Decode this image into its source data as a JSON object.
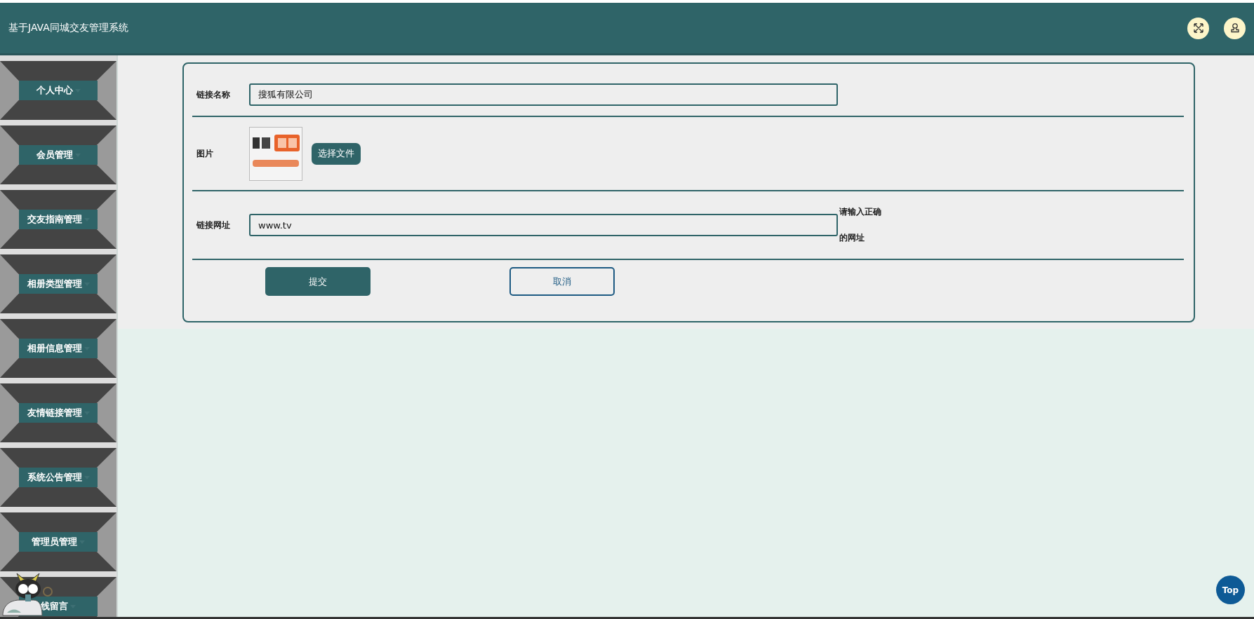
{
  "header": {
    "title": "基于JAVA同城交友管理系统"
  },
  "sidebar": {
    "items": [
      {
        "label": "个人中心"
      },
      {
        "label": "会员管理"
      },
      {
        "label": "交友指南管理"
      },
      {
        "label": "相册类型管理"
      },
      {
        "label": "相册信息管理"
      },
      {
        "label": "友情链接管理"
      },
      {
        "label": "系统公告管理"
      },
      {
        "label": "管理员管理"
      },
      {
        "label": "线留言"
      }
    ]
  },
  "form": {
    "fields": [
      {
        "kind": "text",
        "label": "链接名称",
        "value": "搜狐有限公司"
      },
      {
        "label": "图片",
        "button": "选择文件"
      },
      {
        "kind": "text",
        "label": "链接网址",
        "value": "www.tv",
        "hint": "请输入正确的网址"
      }
    ],
    "actions": [
      {
        "kind": "primary",
        "label": "提交"
      },
      {
        "kind": "secondary",
        "label": "取消"
      }
    ]
  },
  "top_button": "Top"
}
